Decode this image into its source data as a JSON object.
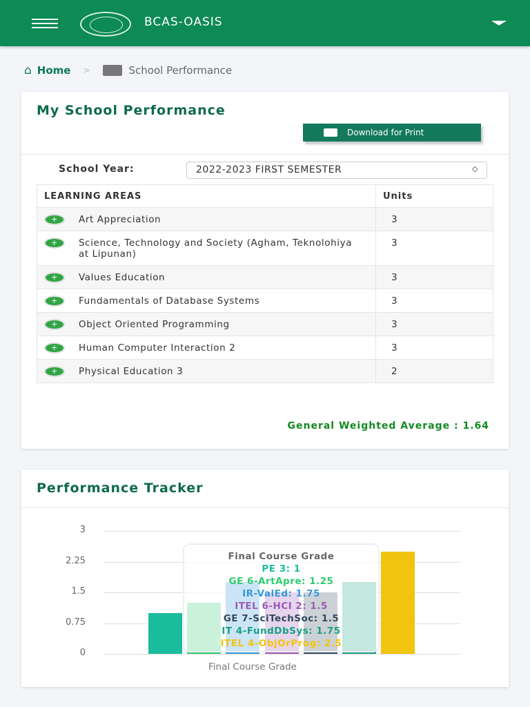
{
  "header": {
    "title": "BCAS-OASIS"
  },
  "breadcrumb": {
    "home": "Home",
    "separator": ">",
    "current": "School Performance"
  },
  "performance": {
    "title": "My School Performance",
    "download_label": "Download for Print",
    "school_year_label": "School Year:",
    "school_year_value": "2022-2023 FIRST SEMESTER",
    "columns": [
      "LEARNING AREAS",
      "Units"
    ],
    "rows": [
      {
        "name": "Art Appreciation",
        "units": "3"
      },
      {
        "name": "Science, Technology and Society (Agham, Teknolohiya at Lipunan)",
        "units": "3"
      },
      {
        "name": "Values Education",
        "units": "3"
      },
      {
        "name": "Fundamentals of Database Systems",
        "units": "3"
      },
      {
        "name": "Object Oriented Programming",
        "units": "3"
      },
      {
        "name": "Human Computer Interaction 2",
        "units": "3"
      },
      {
        "name": "Physical Education 3",
        "units": "2"
      }
    ],
    "gwa": "General Weighted Average : 1.64"
  },
  "tracker": {
    "title": "Performance Tracker"
  },
  "chart_data": {
    "type": "bar",
    "title": "",
    "xlabel": "Final Course Grade",
    "ylabel": "",
    "ylim": [
      0,
      3
    ],
    "yticks": [
      "3",
      "2.25",
      "1.5",
      "0.75",
      "0"
    ],
    "tooltip_title": "Final Course Grade",
    "series": [
      {
        "name": "PE 3",
        "value": 1,
        "color": "#1abc9c",
        "label": "PE 3: 1"
      },
      {
        "name": "GE 6-ArtApre",
        "value": 1.25,
        "color": "#2ecc71",
        "label": "GE 6-ArtApre: 1.25"
      },
      {
        "name": "IR-ValEd",
        "value": 1.75,
        "color": "#3498db",
        "label": "IR-ValEd: 1.75"
      },
      {
        "name": "ITEL 6-HCI 2",
        "value": 1.5,
        "color": "#9b59b6",
        "label": "ITEL 6-HCI 2: 1.5"
      },
      {
        "name": "GE 7-SciTechSoc",
        "value": 1.5,
        "color": "#34495e",
        "label": "GE 7-SciTechSoc: 1.5"
      },
      {
        "name": "IT 4-FundDbSys",
        "value": 1.75,
        "color": "#16a085",
        "label": "IT 4-FundDbSys: 1.75"
      },
      {
        "name": "ITEL 4-ObjOrProg",
        "value": 2.5,
        "color": "#f1c40f",
        "label": "ITEL 4-ObjOrProg: 2.5"
      }
    ]
  }
}
